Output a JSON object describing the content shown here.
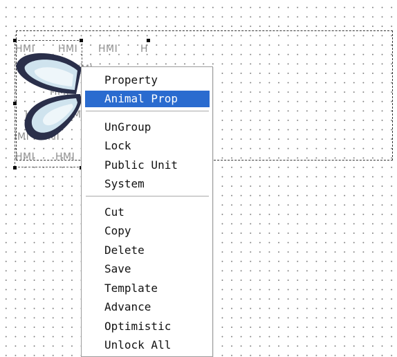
{
  "canvas": {
    "hmi_watermark": "HMI",
    "hmi_watermark_partial": "H"
  },
  "context_menu": {
    "section1": [
      {
        "label": "Property",
        "state": "normal"
      },
      {
        "label": "Animal Prop",
        "state": "highlighted"
      }
    ],
    "section2": [
      {
        "label": "UnGroup"
      },
      {
        "label": "Lock"
      },
      {
        "label": "Public Unit"
      },
      {
        "label": "System"
      }
    ],
    "section3": [
      {
        "label": "Cut"
      },
      {
        "label": "Copy"
      },
      {
        "label": "Delete"
      },
      {
        "label": "Save"
      },
      {
        "label": "Template"
      },
      {
        "label": "Advance"
      },
      {
        "label": "Optimistic"
      },
      {
        "label": "Unlock All"
      }
    ]
  },
  "colors": {
    "highlight": "#2a6bcf",
    "grid_dot": "#7d7d7d",
    "butterfly_outline": "#2a2f4a",
    "butterfly_wing": "#cfe3ee"
  }
}
